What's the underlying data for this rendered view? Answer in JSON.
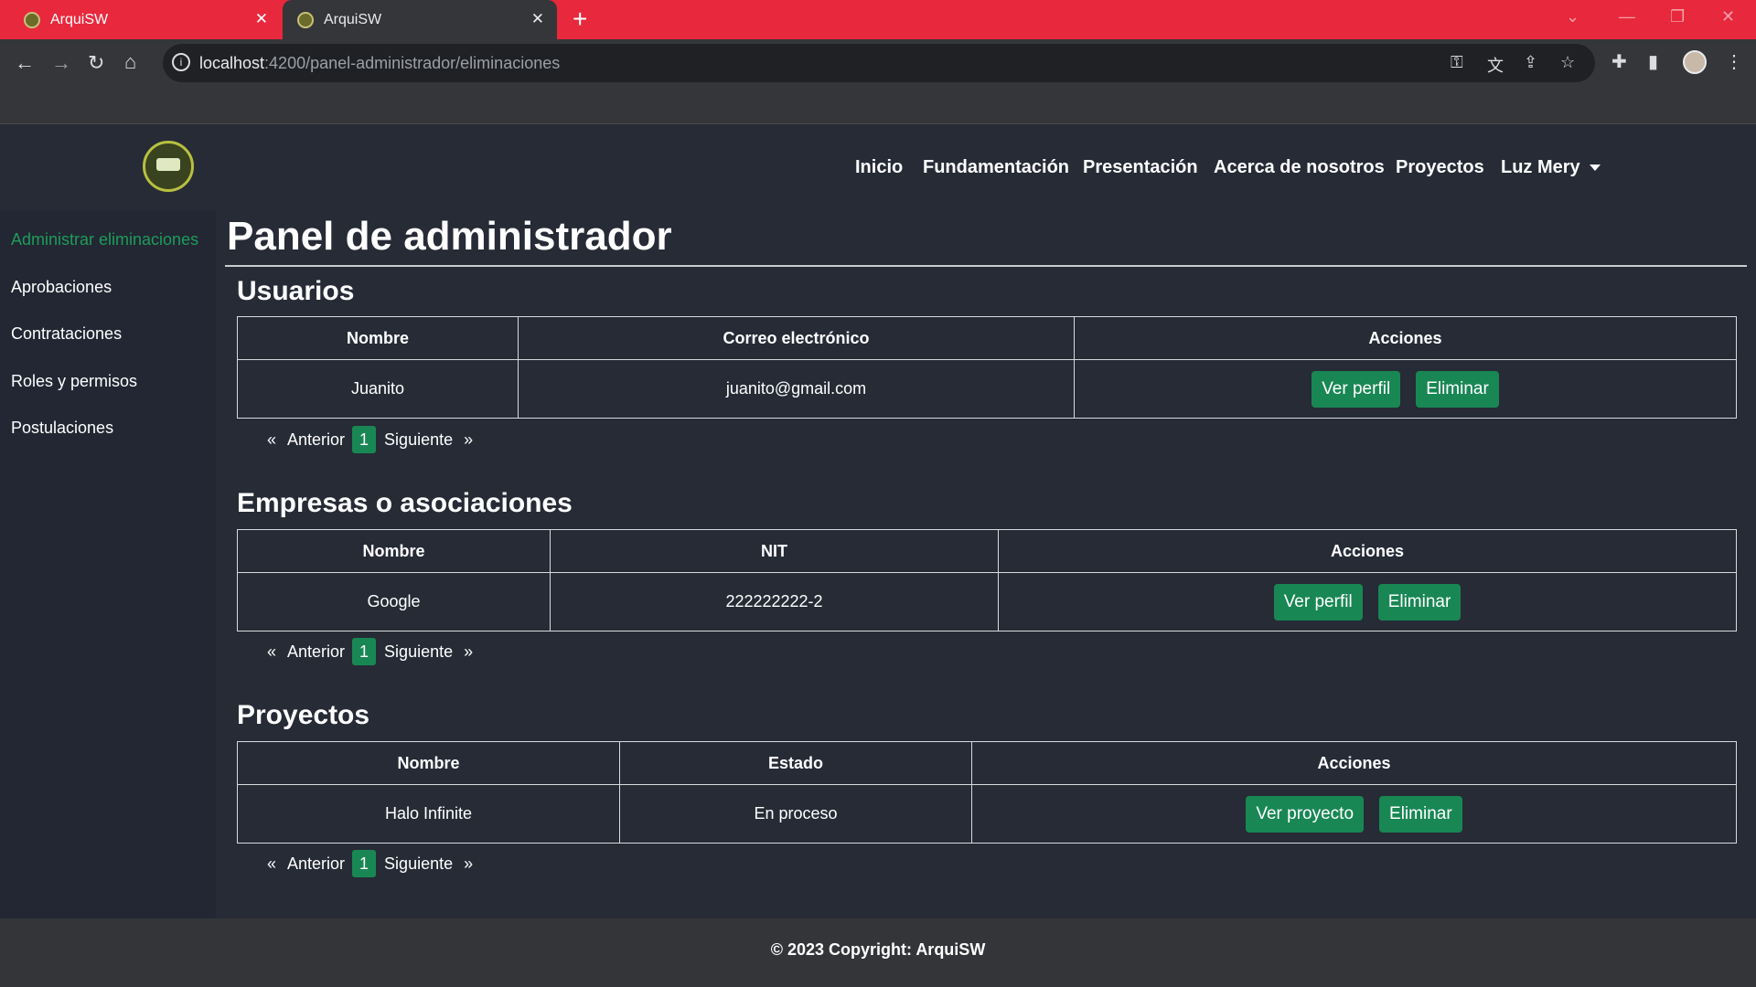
{
  "browser": {
    "tabs": [
      {
        "title": "ArquiSW"
      },
      {
        "title": "ArquiSW"
      }
    ],
    "url_host": "localhost",
    "url_path": ":4200/panel-administrador/eliminaciones",
    "icons": [
      "back-icon",
      "forward-icon",
      "reload-icon",
      "home-icon",
      "key-icon",
      "translate-icon",
      "share-icon",
      "star-icon",
      "extensions-icon",
      "sidepanel-icon",
      "profile-avatar",
      "menu-icon"
    ]
  },
  "header": {
    "nav": [
      "Inicio",
      "Fundamentación",
      "Presentación",
      "Acerca de nosotros",
      "Proyectos"
    ],
    "user": "Luz Mery"
  },
  "sidebar": {
    "items": [
      {
        "label": "Administrar eliminaciones",
        "active": true
      },
      {
        "label": "Aprobaciones"
      },
      {
        "label": "Contrataciones"
      },
      {
        "label": "Roles y permisos"
      },
      {
        "label": "Postulaciones"
      }
    ]
  },
  "main": {
    "title": "Panel de administrador",
    "sections": [
      {
        "title": "Usuarios",
        "columns": [
          "Nombre",
          "Correo electrónico",
          "Acciones"
        ],
        "row": [
          "Juanito",
          "juanito@gmail.com"
        ],
        "actions": [
          "Ver perfil",
          "Eliminar"
        ]
      },
      {
        "title": "Empresas o asociaciones",
        "columns": [
          "Nombre",
          "NIT",
          "Acciones"
        ],
        "row": [
          "Google",
          "222222222-2"
        ],
        "actions": [
          "Ver perfil",
          "Eliminar"
        ]
      },
      {
        "title": "Proyectos",
        "columns": [
          "Nombre",
          "Estado",
          "Acciones"
        ],
        "row": [
          "Halo Infinite",
          "En proceso"
        ],
        "actions": [
          "Ver proyecto",
          "Eliminar"
        ]
      }
    ],
    "pager": {
      "first": "«",
      "prev": "Anterior",
      "page": "1",
      "next": "Siguiente",
      "last": "»"
    }
  },
  "footer": {
    "text": "© 2023 Copyright: ArquiSW"
  },
  "colors": {
    "accent": "#198754",
    "tabbar": "#e8283c",
    "background": "#262b36"
  }
}
